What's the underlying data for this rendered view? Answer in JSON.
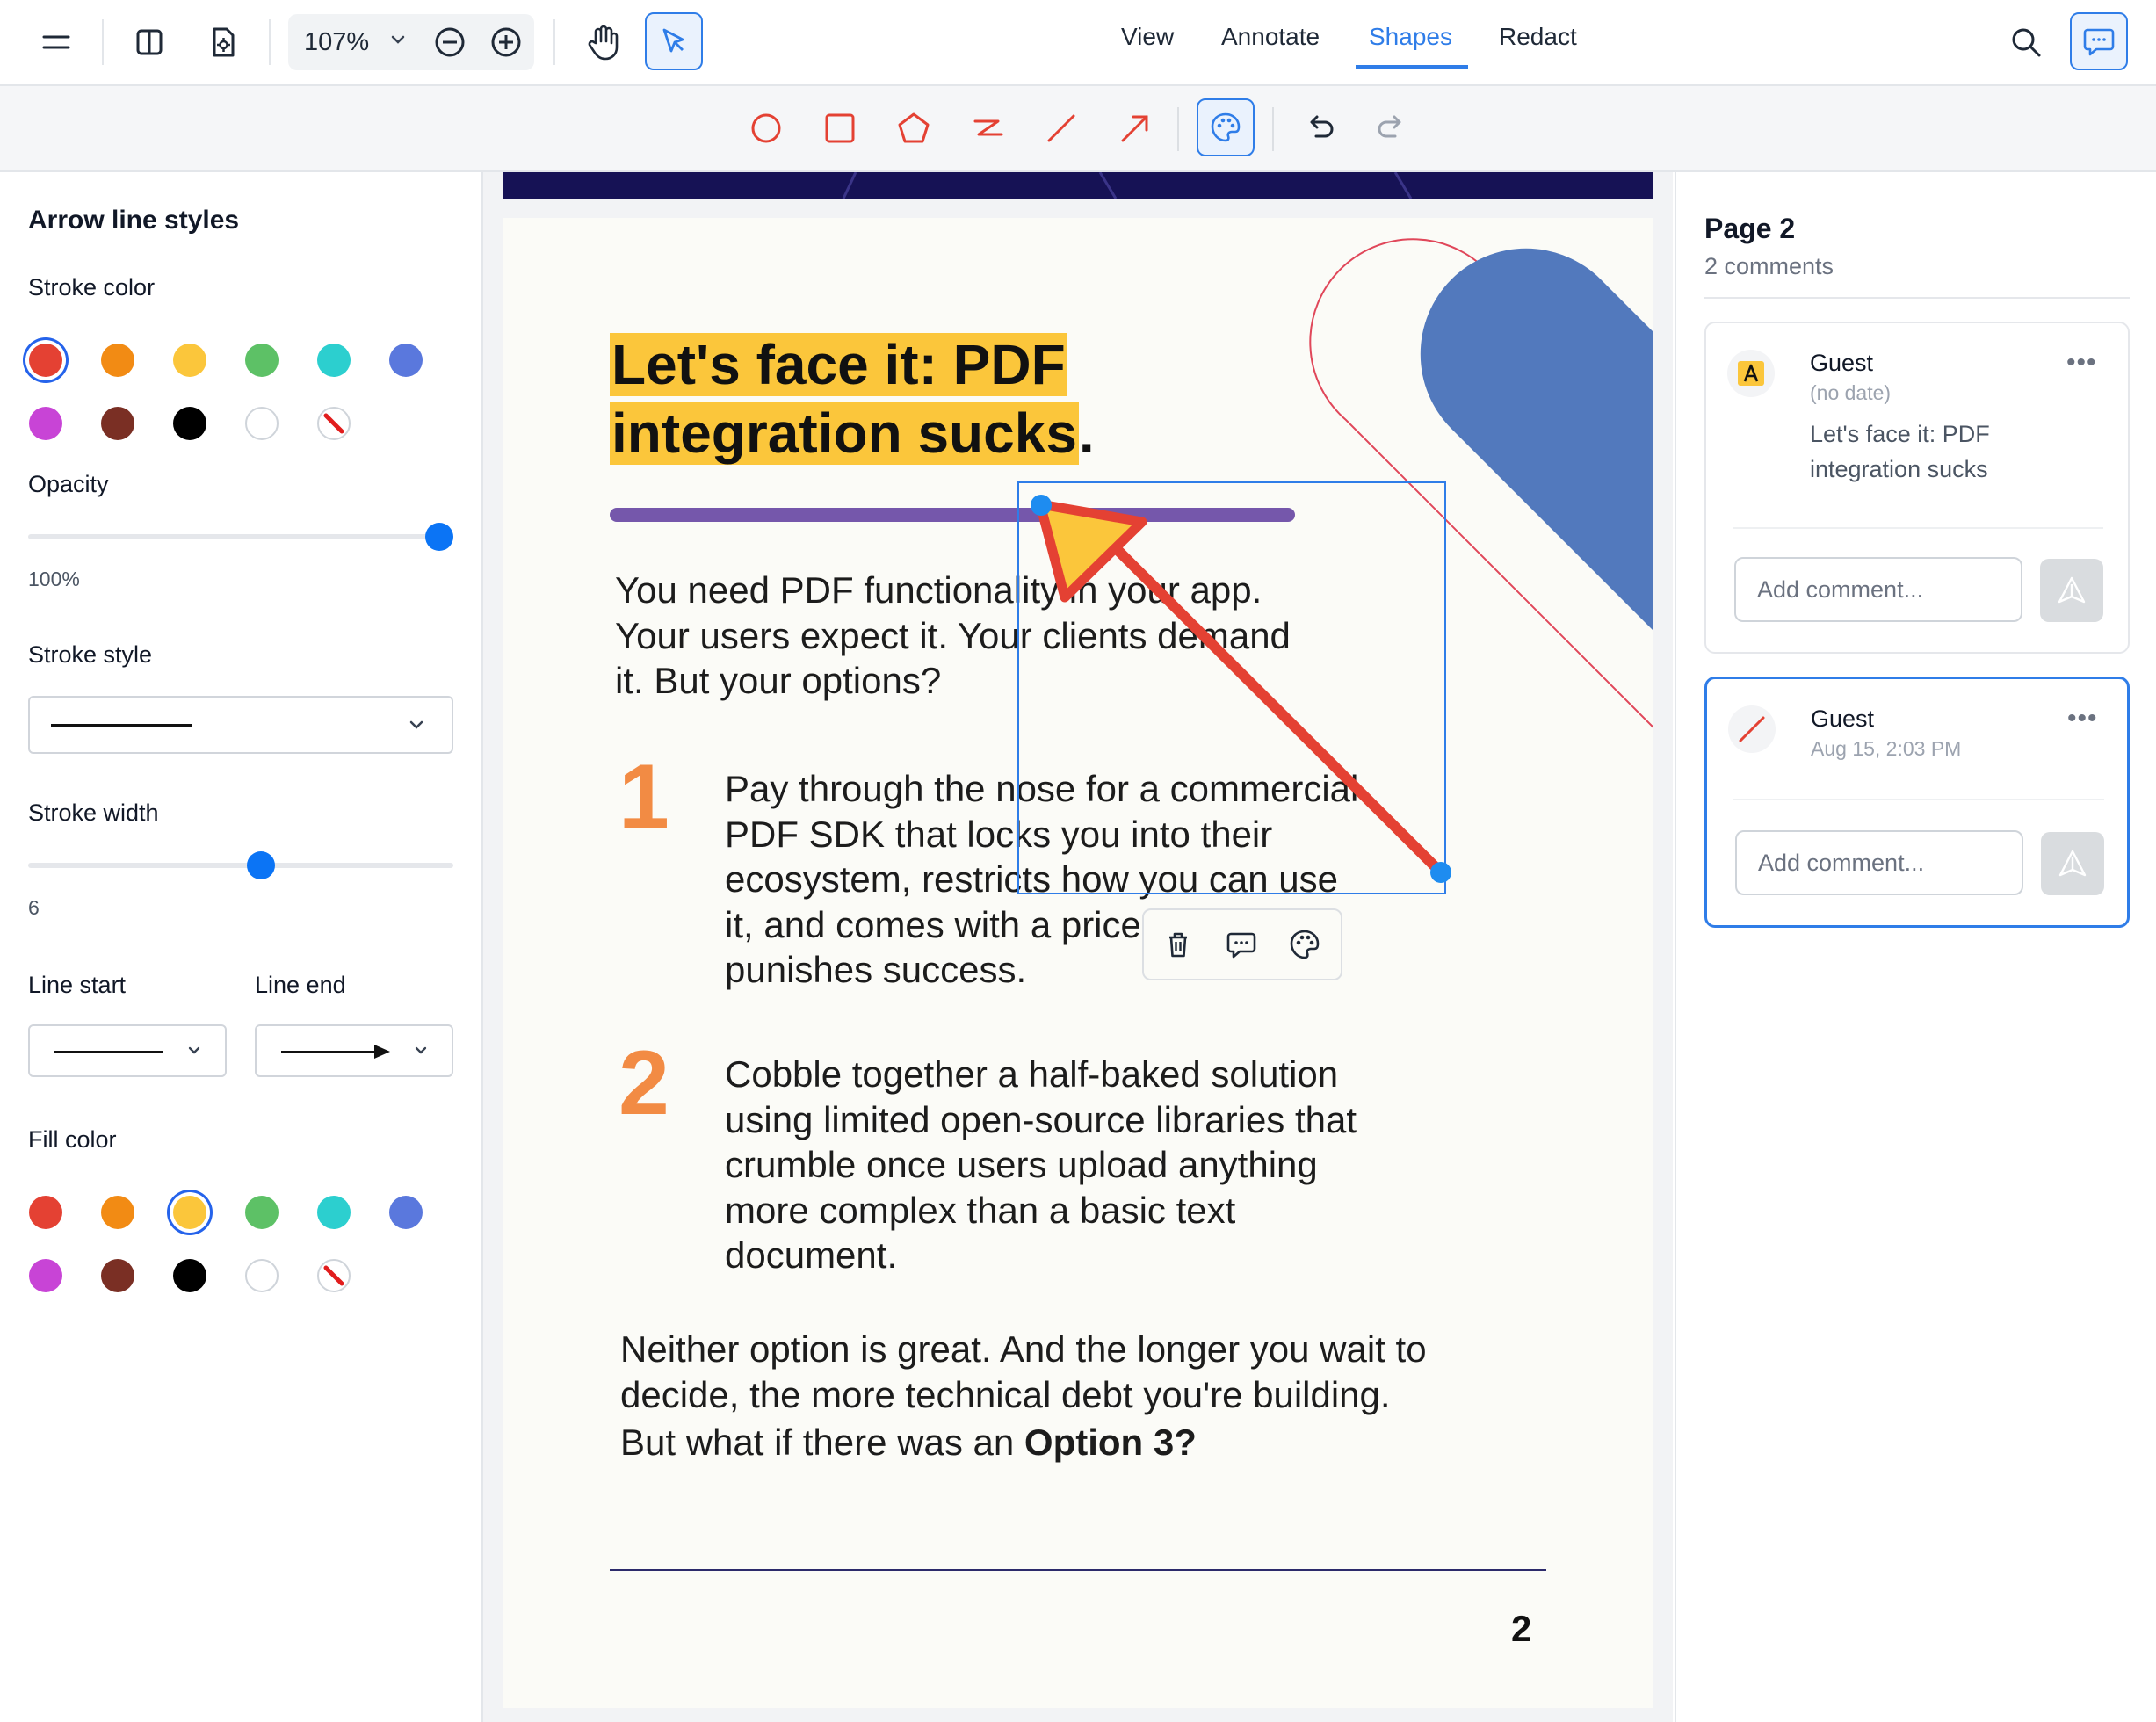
{
  "toolbar": {
    "zoom_value": "107%",
    "tabs": [
      "View",
      "Annotate",
      "Shapes",
      "Redact"
    ],
    "active_tab": "Shapes",
    "accent_color": "#2f7de8"
  },
  "shape_tools": [
    "circle-icon",
    "square-icon",
    "polygon-icon",
    "polyline-icon",
    "line-icon",
    "arrow-icon",
    "palette-icon",
    "undo-icon",
    "redo-icon"
  ],
  "left_panel": {
    "title": "Arrow line styles",
    "stroke_color_label": "Stroke color",
    "stroke_colors": [
      "#e44133",
      "#f28b14",
      "#fbc63b",
      "#5dc166",
      "#2ccfcf",
      "#5a78dd",
      "#c844d6",
      "#7a2f24",
      "#000000",
      "#ffffff",
      "none"
    ],
    "selected_stroke_color": "#e44133",
    "opacity_label": "Opacity",
    "opacity_value": "100%",
    "opacity_fraction": 1.0,
    "stroke_style_label": "Stroke style",
    "stroke_width_label": "Stroke width",
    "stroke_width_value": "6",
    "stroke_width_fraction": 0.55,
    "line_start_label": "Line start",
    "line_end_label": "Line end",
    "fill_color_label": "Fill color",
    "fill_colors": [
      "#e44133",
      "#f28b14",
      "#fbc63b",
      "#5dc166",
      "#2ccfcf",
      "#5a78dd",
      "#c844d6",
      "#7a2f24",
      "#000000",
      "#ffffff",
      "none"
    ],
    "selected_fill_color": "#fbc63b"
  },
  "document": {
    "title_line1": "Let's face it: PDF",
    "title_line2": "integration sucks",
    "title_period": ".",
    "intro_lines": [
      "You need PDF functionality in your app.",
      "Your users expect it. Your clients demand",
      "it. But your options?"
    ],
    "item1_number": "1",
    "item1_lines": [
      "Pay through the nose for a commercial",
      "PDF SDK that locks you into their",
      "ecosystem, restricts how you can use",
      "it, and comes with a price tag that",
      "punishes success."
    ],
    "item2_number": "2",
    "item2_lines": [
      "Cobble together a half-baked solution",
      "using limited open-source libraries that",
      "crumble once users upload anything",
      "more complex than a basic text",
      "document."
    ],
    "closing_lines": [
      "Neither option is great. And the longer you wait to",
      "decide, the more technical debt you're building."
    ],
    "question_prefix": "But what if there was an",
    "question_bold": "Option 3?",
    "page_number": "2",
    "highlight_color": "#fbc63b",
    "number_color": "#f28b44"
  },
  "selection_popup": [
    "trash-icon",
    "comment-icon",
    "palette-icon"
  ],
  "comments_panel": {
    "page_title": "Page 2",
    "comment_count": "2 comments",
    "comments": [
      {
        "author": "Guest",
        "date": "(no date)",
        "body": "Let's face it: PDF integration sucks",
        "placeholder": "Add comment..."
      },
      {
        "author": "Guest",
        "date": "Aug 15, 2:03 PM",
        "body": "",
        "placeholder": "Add comment..."
      }
    ]
  }
}
